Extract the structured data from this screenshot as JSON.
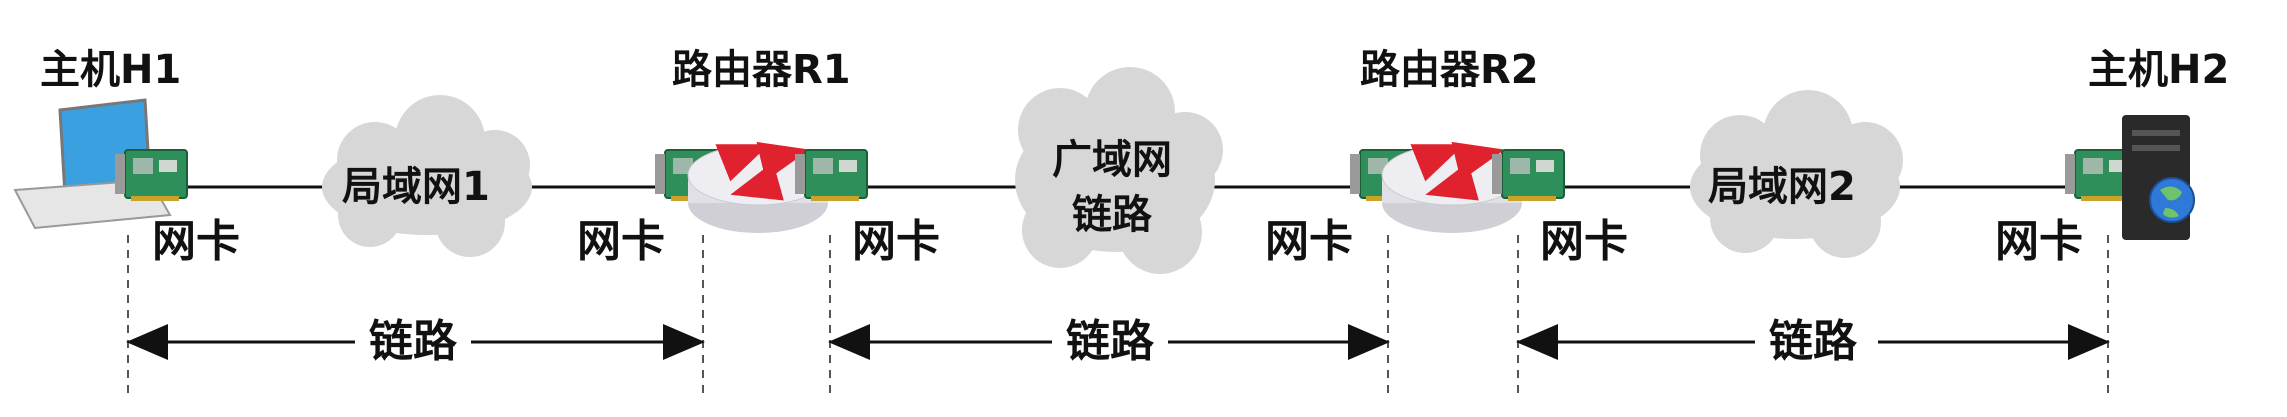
{
  "nodes": {
    "h1": {
      "title": "主机H1"
    },
    "r1": {
      "title": "路由器R1"
    },
    "r2": {
      "title": "路由器R2"
    },
    "h2": {
      "title": "主机H2"
    }
  },
  "clouds": {
    "lan1": "局域网1",
    "wan_line1": "广域网",
    "wan_line2": "链路",
    "lan2": "局域网2"
  },
  "nic_label": "网卡",
  "link_label": "链路",
  "colors": {
    "cloud": "#d7d7d7",
    "line": "#111111",
    "nic_board": "#2f8f5b",
    "router": "#e9e9ee",
    "router_arrow": "#e0222e",
    "server": "#2a2a2a"
  }
}
